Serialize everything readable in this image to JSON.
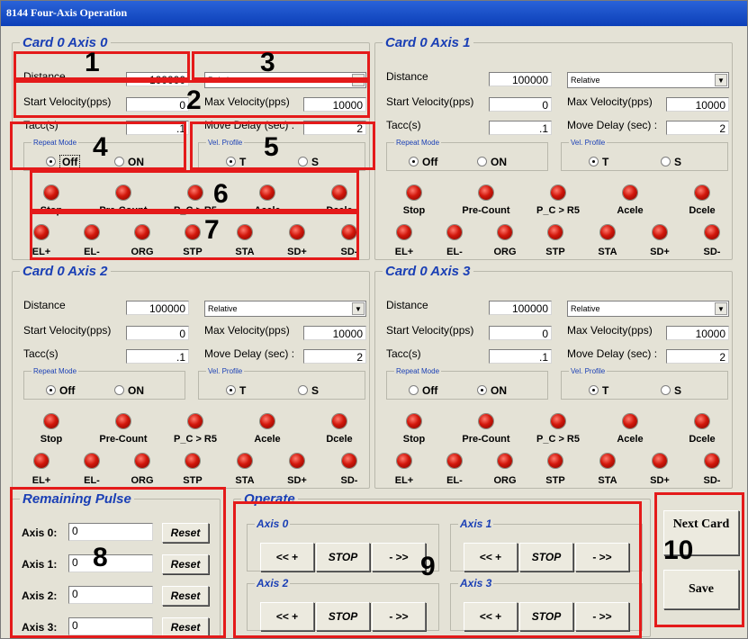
{
  "window": {
    "title": "8144 Four-Axis Operation"
  },
  "labels": {
    "distance": "Distance",
    "start_velocity": "Start Velocity(pps)",
    "max_velocity": "Max Velocity(pps)",
    "tacc": "Tacc(s)",
    "move_delay": "Move Delay (sec) :",
    "repeat_mode": "Repeat Mode",
    "vel_profile": "Vel. Profile",
    "off": "Off",
    "on": "ON",
    "t": "T",
    "s": "S"
  },
  "indicators_row1": [
    "Stop",
    "Pre-Count",
    "P_C > R5",
    "Acele",
    "Dcele"
  ],
  "indicators_row2": [
    "EL+",
    "EL-",
    "ORG",
    "STP",
    "STA",
    "SD+",
    "SD-"
  ],
  "axes": [
    {
      "title": "Card 0 Axis 0",
      "distance": "100000",
      "mode": "Relative",
      "start_velocity": "0",
      "max_velocity": "10000",
      "tacc": ".1",
      "move_delay": "2",
      "repeat": "off",
      "profile": "T"
    },
    {
      "title": "Card 0 Axis 1",
      "distance": "100000",
      "mode": "Relative",
      "start_velocity": "0",
      "max_velocity": "10000",
      "tacc": ".1",
      "move_delay": "2",
      "repeat": "off",
      "profile": "T"
    },
    {
      "title": "Card 0 Axis 2",
      "distance": "100000",
      "mode": "Relative",
      "start_velocity": "0",
      "max_velocity": "10000",
      "tacc": ".1",
      "move_delay": "2",
      "repeat": "off",
      "profile": "T"
    },
    {
      "title": "Card 0 Axis 3",
      "distance": "100000",
      "mode": "Relative",
      "start_velocity": "0",
      "max_velocity": "10000",
      "tacc": ".1",
      "move_delay": "2",
      "repeat": "on",
      "profile": "T"
    }
  ],
  "remaining": {
    "title": "Remaining Pulse",
    "rows": [
      {
        "label": "Axis 0:",
        "value": "0",
        "button": "Reset"
      },
      {
        "label": "Axis 1:",
        "value": "0",
        "button": "Reset"
      },
      {
        "label": "Axis 2:",
        "value": "0",
        "button": "Reset"
      },
      {
        "label": "Axis 3:",
        "value": "0",
        "button": "Reset"
      }
    ]
  },
  "operate": {
    "title": "Operate",
    "groups": [
      {
        "label": "Axis 0",
        "minus": "<< +",
        "stop": "STOP",
        "plus": "- >>"
      },
      {
        "label": "Axis 1",
        "minus": "<< +",
        "stop": "STOP",
        "plus": "- >>"
      },
      {
        "label": "Axis 2",
        "minus": "<< +",
        "stop": "STOP",
        "plus": "- >>"
      },
      {
        "label": "Axis 3",
        "minus": "<< +",
        "stop": "STOP",
        "plus": "- >>"
      }
    ]
  },
  "buttons": {
    "next_card": "Next Card",
    "save": "Save"
  },
  "callouts": [
    "1",
    "2",
    "3",
    "4",
    "5",
    "6",
    "7",
    "8",
    "9",
    "10"
  ],
  "colors": {
    "legend_blue": "#1a3fb5",
    "callout_red": "#e41a1a",
    "led_red": "#d2170b",
    "title_blue": "#0c3fb8"
  }
}
